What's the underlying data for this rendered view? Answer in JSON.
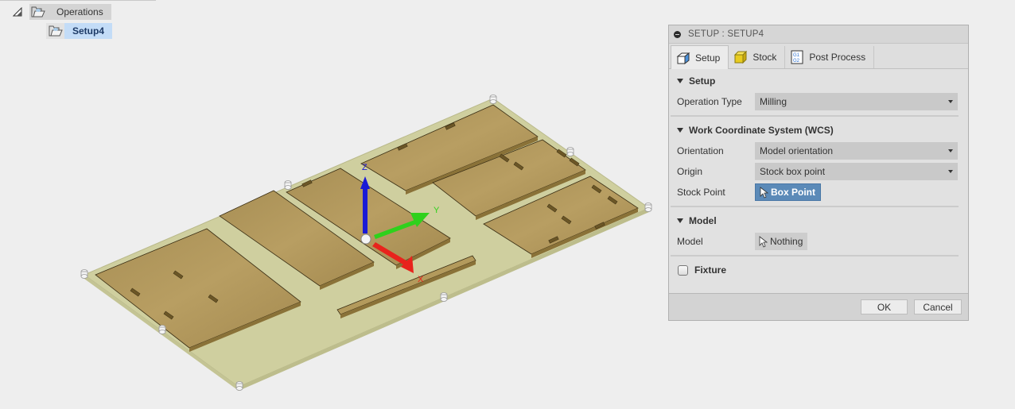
{
  "browser": {
    "root": {
      "label": "Operations",
      "icon": "folder-icon",
      "expanded": true
    },
    "children": [
      {
        "label": "Setup4",
        "icon": "setup-folder-icon",
        "selected": true
      }
    ]
  },
  "viewport": {
    "triad": {
      "x_label": "X",
      "y_label": "Y",
      "z_label": "Z"
    },
    "colors": {
      "x_axis": "#e8231c",
      "y_axis": "#2fd11c",
      "z_axis": "#1a1ad6",
      "stock": "#cfcf9e",
      "wood": "#b39a5c"
    }
  },
  "panel": {
    "title": "SETUP : SETUP4",
    "tabs": [
      {
        "label": "Setup",
        "icon": "setup-cube-icon",
        "active": true
      },
      {
        "label": "Stock",
        "icon": "stock-box-icon",
        "active": false
      },
      {
        "label": "Post Process",
        "icon": "post-process-g1g2-icon",
        "active": false
      }
    ],
    "sections": {
      "setup": {
        "title": "Setup",
        "operation_type_label": "Operation Type",
        "operation_type_value": "Milling"
      },
      "wcs": {
        "title": "Work Coordinate System (WCS)",
        "orientation_label": "Orientation",
        "orientation_value": "Model orientation",
        "origin_label": "Origin",
        "origin_value": "Stock box point",
        "stock_point_label": "Stock Point",
        "stock_point_value": "Box Point"
      },
      "model": {
        "title": "Model",
        "model_label": "Model",
        "model_value": "Nothing"
      },
      "fixture": {
        "label": "Fixture",
        "checked": false
      }
    },
    "buttons": {
      "ok": "OK",
      "cancel": "Cancel"
    },
    "accent_color": "#5b8ab8"
  }
}
